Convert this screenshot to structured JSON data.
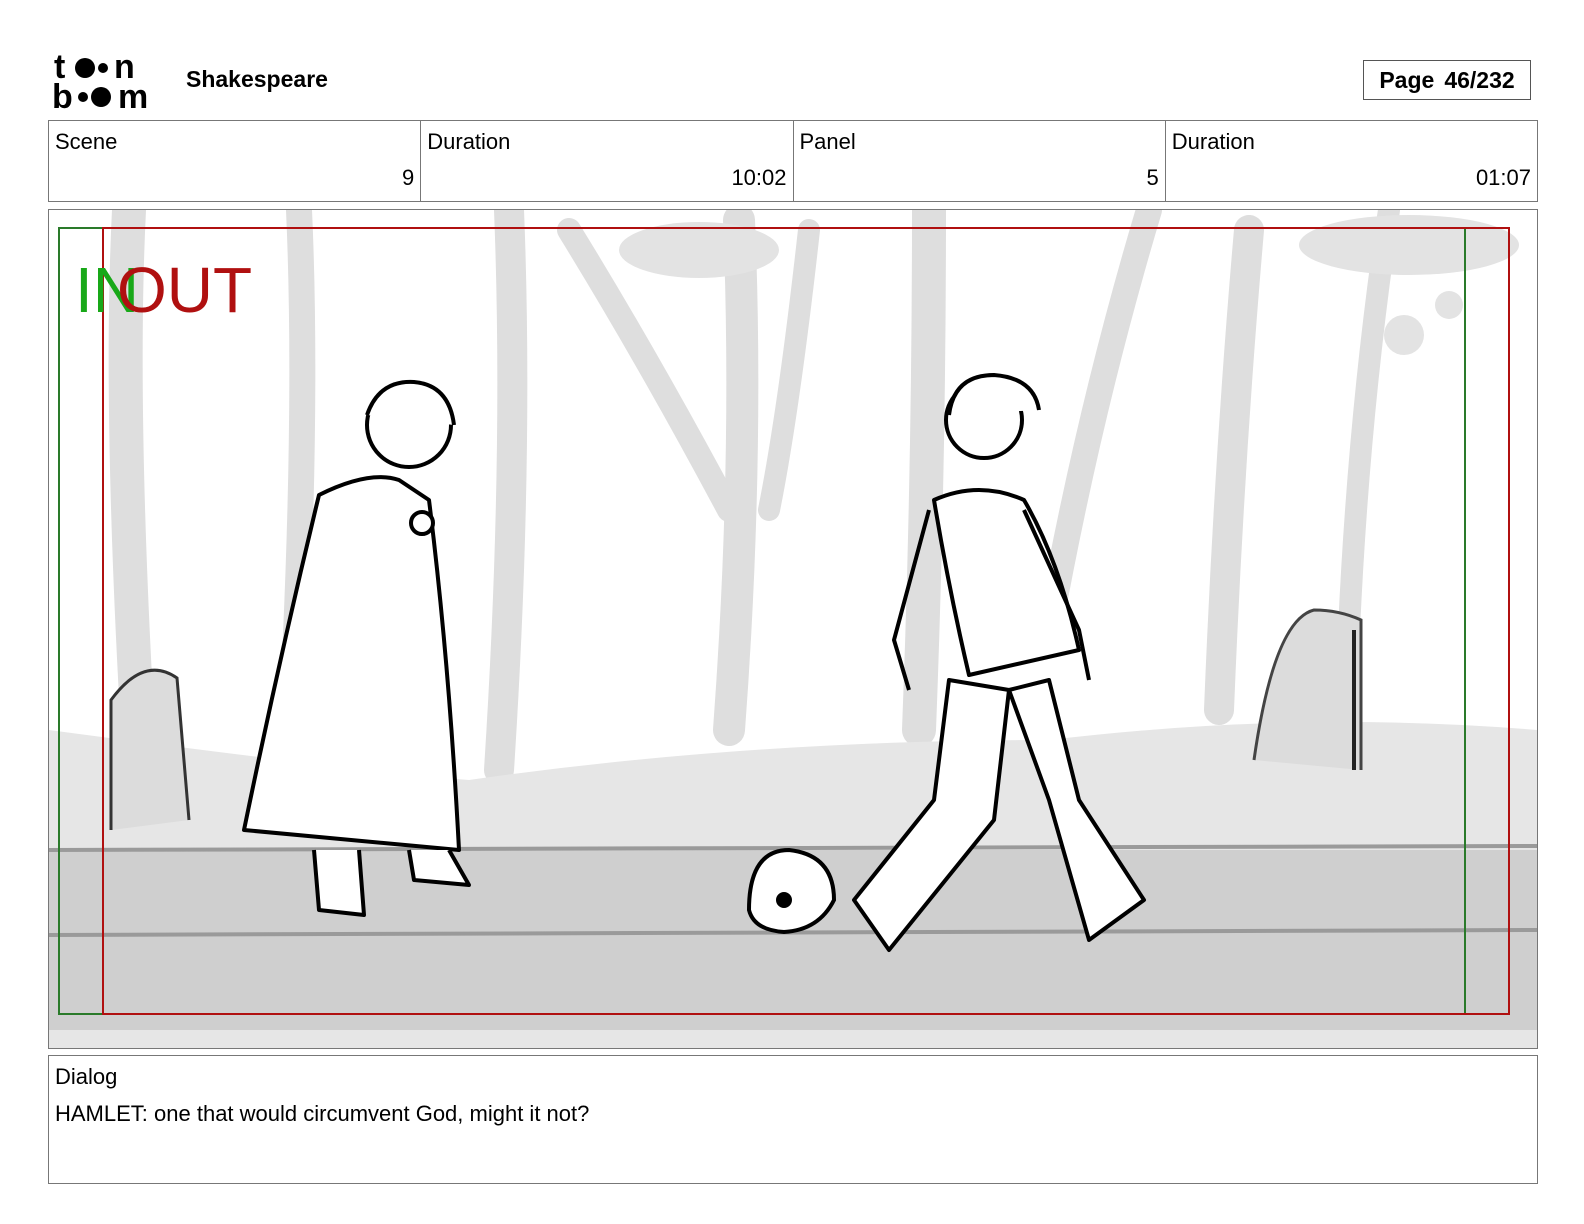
{
  "header": {
    "logo_icon": "toonboom-logo",
    "logo_text": "toon boom",
    "project_title": "Shakespeare",
    "page_label": "Page",
    "page_value": "46/232"
  },
  "info": [
    {
      "label": "Scene",
      "value": "9"
    },
    {
      "label": "Duration",
      "value": "10:02"
    },
    {
      "label": "Panel",
      "value": "5"
    },
    {
      "label": "Duration",
      "value": "01:07"
    }
  ],
  "panel": {
    "in_marker": "IN",
    "out_marker": "OUT",
    "in_color": "#18a818",
    "out_color": "#b01010",
    "drawing": "storyboard-sketch"
  },
  "dialog": {
    "label": "Dialog",
    "text": "HAMLET: one that would circumvent God, might it not?"
  }
}
